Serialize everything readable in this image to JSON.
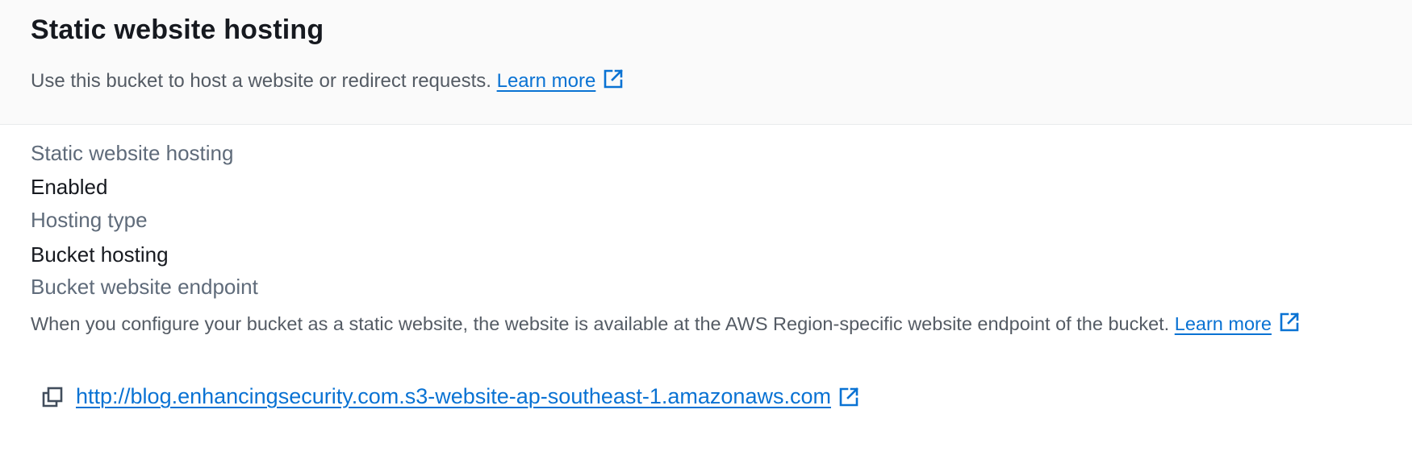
{
  "header": {
    "title": "Static website hosting",
    "description": "Use this bucket to host a website or redirect requests.",
    "learn_more": "Learn more",
    "external_icon": "external-link-icon"
  },
  "fields": {
    "hosting_label": "Static website hosting",
    "hosting_value": "Enabled",
    "type_label": "Hosting type",
    "type_value": "Bucket hosting",
    "endpoint_label": "Bucket website endpoint",
    "endpoint_description": "When you configure your bucket as a static website, the website is available at the AWS Region-specific website endpoint of the bucket.",
    "endpoint_learn_more": "Learn more",
    "endpoint_url": "http://blog.enhancingsecurity.com.s3-website-ap-southeast-1.amazonaws.com",
    "copy_icon": "copy-icon"
  },
  "colors": {
    "link": "#0972d3",
    "header_bg": "#fafafa",
    "label": "#5f6b7a",
    "text": "#16191f"
  }
}
